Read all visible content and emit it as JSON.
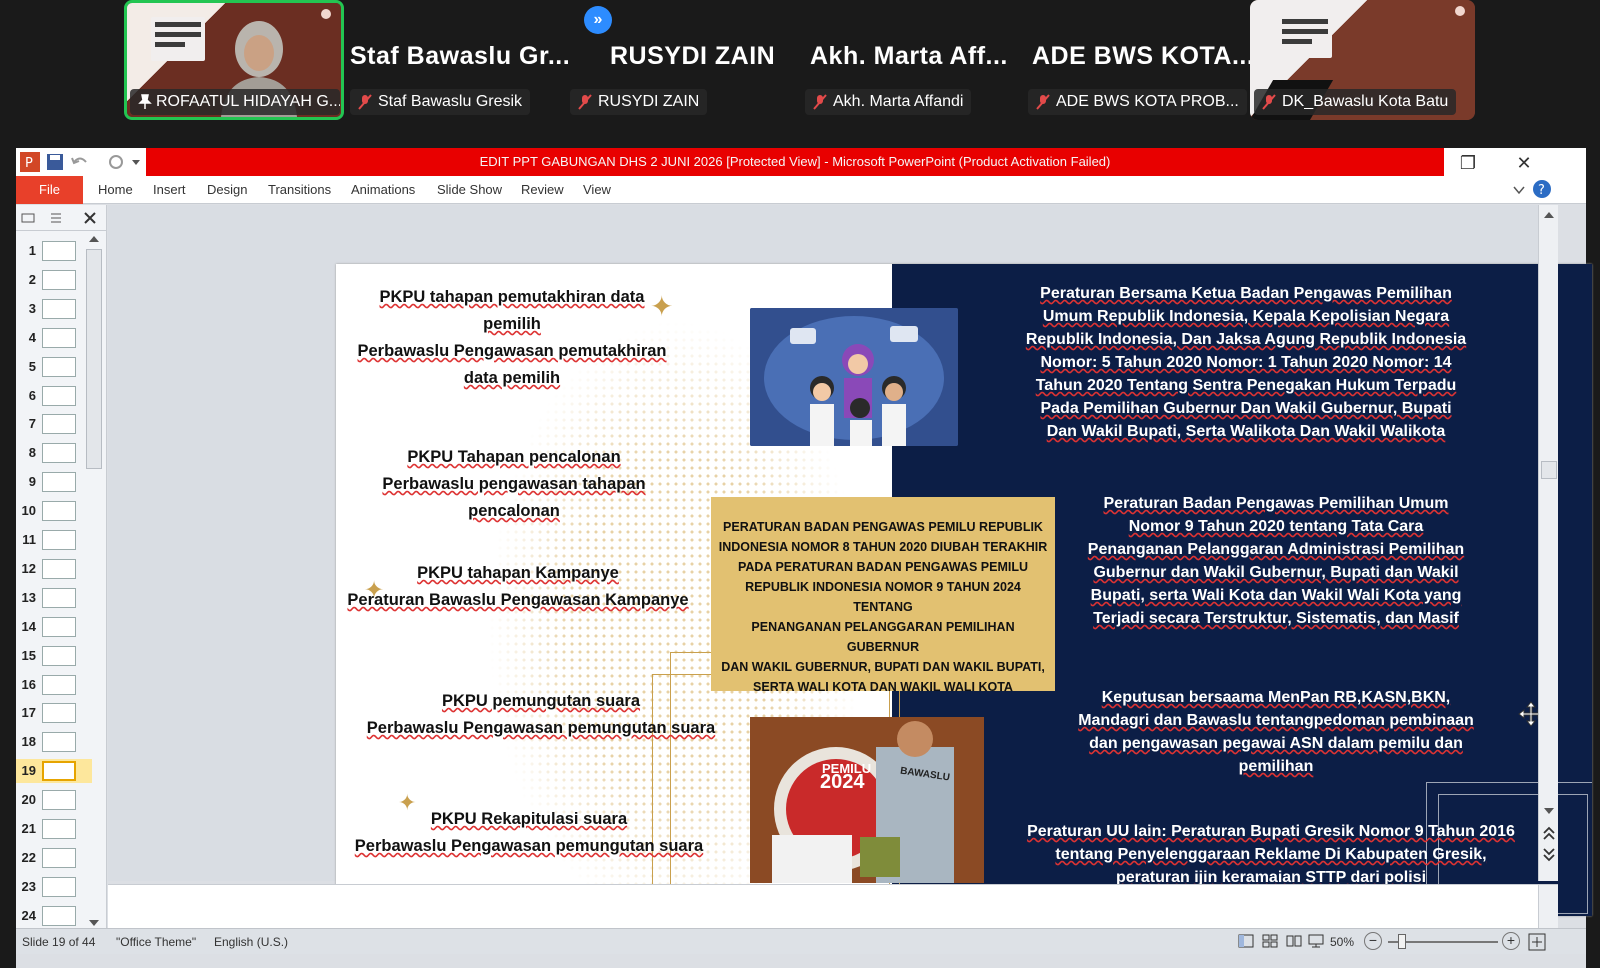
{
  "meeting": {
    "tiles": [
      {
        "label": "ROFAATUL HIDAYAH G...",
        "video": true,
        "active": true
      },
      {
        "label": "Staf Bawaslu Gresik",
        "big_name": "Staf  Bawaslu  Gr..."
      },
      {
        "label": "RUSYDI ZAIN",
        "big_name": "RUSYDI ZAIN"
      },
      {
        "label": "Akh. Marta Affandi",
        "big_name": "Akh.  Marta  Aff..."
      },
      {
        "label": "ADE BWS KOTA PROB...",
        "big_name": "ADE  BWS  KOTA..."
      },
      {
        "label": "DK_Bawaslu Kota Batu",
        "video": true
      }
    ],
    "next_icon": "double-chevron-right-icon",
    "next_glyph": "»"
  },
  "window": {
    "title": "EDIT PPT GABUNGAN DHS 2 JUNI 2026 [Protected View] - Microsoft PowerPoint (Product Activation Failed)",
    "restore_glyph": "❐",
    "close_glyph": "✕"
  },
  "ribbon": {
    "file": "File",
    "tabs": [
      "Home",
      "Insert",
      "Design",
      "Transitions",
      "Animations",
      "Slide Show",
      "Review",
      "View"
    ]
  },
  "thumbnails": {
    "numbers": [
      "1",
      "2",
      "3",
      "4",
      "5",
      "6",
      "7",
      "8",
      "9",
      "10",
      "11",
      "12",
      "13",
      "14",
      "15",
      "16",
      "17",
      "18",
      "19",
      "20",
      "21",
      "22",
      "23",
      "24"
    ],
    "selected": "19"
  },
  "slide": {
    "left": {
      "b1": [
        "PKPU tahapan pemutakhiran data",
        "pemilih",
        "Perbawaslu Pengawasan pemutakhiran",
        "data pemilih"
      ],
      "b2": [
        "PKPU Tahapan pencalonan",
        "Perbawaslu pengawasan tahapan",
        "pencalonan"
      ],
      "b3": [
        "PKPU tahapan Kampanye",
        "Peraturan Bawaslu Pengawasan Kampanye"
      ],
      "b4": [
        "PKPU pemungutan suara",
        "Perbawaslu Pengawasan pemungutan suara"
      ],
      "b5": [
        "PKPU Rekapitulasi  suara",
        "Perbawaslu Pengawasan pemungutan suara"
      ]
    },
    "center_box": [
      "PERATURAN BADAN PENGAWAS PEMILU REPUBLIK",
      "INDONESIA NOMOR 8 TAHUN 2020  DIUBAH TERAKHIR",
      "PADA  PERATURAN BADAN PENGAWAS PEMILU",
      "REPUBLIK INDONESIA NOMOR 9 TAHUN 2024 TENTANG",
      "PENANGANAN PELANGGARAN PEMILIHAN GUBERNUR",
      "DAN WAKIL GUBERNUR, BUPATI DAN WAKIL BUPATI,",
      "SERTA WALI KOTA DAN WAKIL WALI KOTA"
    ],
    "image2_text": {
      "line1": "PEMILU",
      "line2": "2024",
      "vest": "BAWASLU"
    },
    "right": {
      "r1": [
        "Peraturan Bersama Ketua Badan Pengawas Pemilihan",
        "Umum Republik Indonesia, Kepala Kepolisian Negara",
        "Republik Indonesia, Dan Jaksa Agung Republik Indonesia",
        "Nomor: 5 Tahun 2020 Nomor: 1 Tahun 2020 Nomor: 14",
        "Tahun 2020  Tentang Sentra Penegakan Hukum Terpadu",
        "Pada Pemilihan Gubernur Dan Wakil Gubernur, Bupati",
        "Dan Wakil Bupati, Serta Walikota Dan Wakil Walikota"
      ],
      "r2": [
        "Peraturan Badan Pengawas Pemilihan Umum",
        "Nomor 9 Tahun 2020 tentang Tata Cara",
        "Penanganan Pelanggaran Administrasi Pemilihan",
        "Gubernur dan Wakil Gubernur, Bupati dan Wakil",
        "Bupati, serta Wali Kota dan Wakil Wali Kota yang",
        "Terjadi secara Terstruktur, Sistematis, dan Masif"
      ],
      "r3": [
        "Keputusan bersaama MenPan RB,KASN,BKN,",
        "Mandagri dan Bawaslu tentangpedoman pembinaan",
        "dan pengawasan pegawai ASN dalam pemilu dan",
        "pemilihan"
      ],
      "r4": [
        "Peraturan UU lain: Peraturan Bupati Gresik Nomor 9  Tahun 2016",
        "tentang Penyelenggaraan Reklame Di Kabupaten Gresik,",
        "peraturan ijin keramaian STTP dari polisi"
      ]
    }
  },
  "status": {
    "slide": "Slide 19 of 44",
    "theme": "\"Office Theme\"",
    "lang": "English (U.S.)",
    "zoom": "50%",
    "zoom_minus": "−",
    "zoom_plus": "+"
  },
  "colors": {
    "title_red": "#e80000",
    "file_orange": "#e8402a",
    "slide_navy": "#0c1e46",
    "gold": "#e2c171",
    "active_green": "#23c552"
  }
}
